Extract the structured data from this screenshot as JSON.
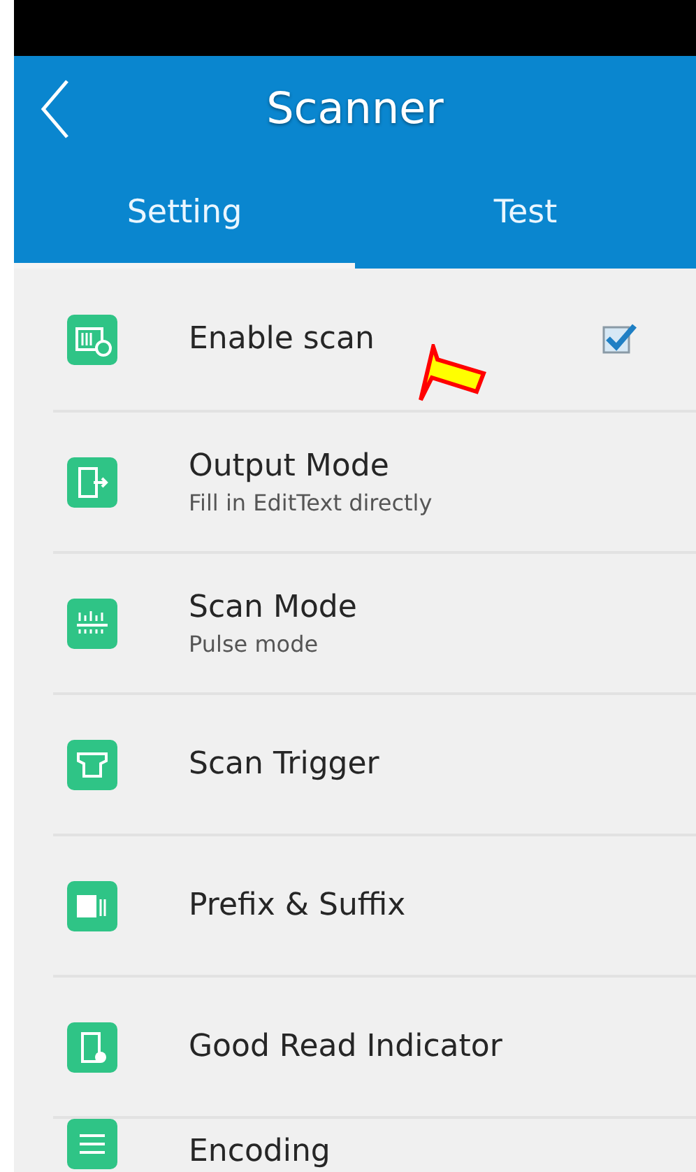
{
  "header": {
    "title": "Scanner"
  },
  "tabs": [
    {
      "label": "Setting",
      "selected": true
    },
    {
      "label": "Test",
      "selected": false
    }
  ],
  "settings": [
    {
      "kind": "checkbox",
      "title": "Enable scan",
      "checked": true
    },
    {
      "kind": "link",
      "title": "Output Mode",
      "subtitle": "Fill in EditText directly"
    },
    {
      "kind": "link",
      "title": "Scan Mode",
      "subtitle": "Pulse mode"
    },
    {
      "kind": "link",
      "title": "Scan Trigger"
    },
    {
      "kind": "link",
      "title": "Prefix & Suffix"
    },
    {
      "kind": "link",
      "title": "Good Read Indicator"
    },
    {
      "kind": "link",
      "title": "Encoding"
    }
  ]
}
